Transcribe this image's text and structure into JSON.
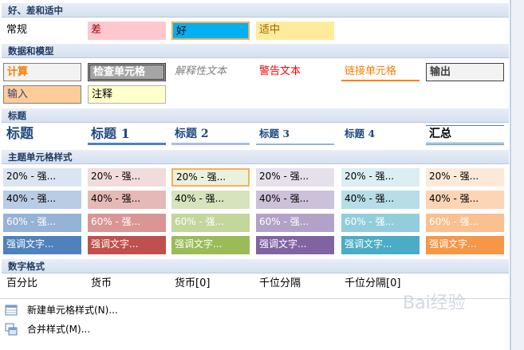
{
  "sections": {
    "good_bad": "好、差和适中",
    "data_model": "数据和模型",
    "titles": "标题",
    "theme": "主题单元格样式",
    "number": "数字格式"
  },
  "good_bad_row": [
    "常规",
    "差",
    "好",
    "适中"
  ],
  "data_row1": [
    "计算",
    "检查单元格",
    "解释性文本",
    "警告文本",
    "链接单元格",
    "输出"
  ],
  "data_row2": [
    "输入",
    "注释"
  ],
  "titles_row": [
    "标题",
    "标题 1",
    "标题 2",
    "标题 3",
    "标题 4",
    "汇总"
  ],
  "theme_rows": [
    [
      "20% - 强...",
      "20% - 强...",
      "20% - 强...",
      "20% - 强...",
      "20% - 强...",
      "20% - 强..."
    ],
    [
      "40% - 强...",
      "40% - 强...",
      "40% - 强...",
      "40% - 强...",
      "40% - 强...",
      "40% - 强..."
    ],
    [
      "60% - 强...",
      "60% - 强...",
      "60% - 强...",
      "60% - 强...",
      "60% - 强...",
      "60% - 强..."
    ],
    [
      "强调文字...",
      "强调文字...",
      "强调文字...",
      "强调文字...",
      "强调文字...",
      "强调文字..."
    ]
  ],
  "number_row": [
    "百分比",
    "货币",
    "货币[0]",
    "千位分隔",
    "千位分隔[0]"
  ],
  "footer": {
    "new_style": "新建单元格样式(N)...",
    "merge_styles": "合并样式(M)..."
  },
  "colors": {
    "bad_bg": "#ffc7ce",
    "bad_fg": "#9c0006",
    "good_bg": "#00b0f0",
    "neutral_bg": "#ffeb9c",
    "neutral_fg": "#9c6500",
    "accent": [
      "#4f81bd",
      "#c0504d",
      "#9bbb59",
      "#8064a2",
      "#4bacc6",
      "#f79646"
    ]
  },
  "watermark": "Bai经验"
}
